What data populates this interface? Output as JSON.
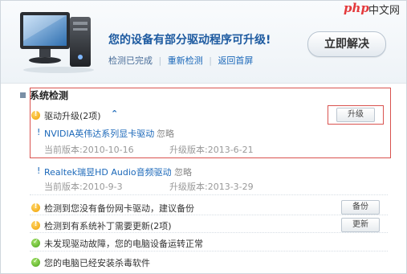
{
  "header": {
    "headline": "您的设备有部分驱动程序可升级!",
    "status_text": "检测已完成",
    "recheck_link": "重新检测",
    "back_link": "返回首屏",
    "fix_button": "立即解决"
  },
  "watermark": {
    "php": "php",
    "cn": "中文网"
  },
  "section": {
    "title": "系统检测",
    "upgrade_label": "驱动升级(2项)",
    "upgrade_button": "升级"
  },
  "drivers": [
    {
      "mark": "!",
      "name": "NVIDIA英伟达系列显卡驱动",
      "ignore": "忽略",
      "current": "当前版本:2010-10-16",
      "upgrade": "升级版本:2013-6-21"
    },
    {
      "mark": "!",
      "name": "Realtek瑞昱HD Audio音频驱动",
      "ignore": "忽略",
      "current": "当前版本:2010-9-3",
      "upgrade": "升级版本:2013-3-29"
    }
  ],
  "checks": [
    {
      "label": "检测到您没有备份网卡驱动，建议备份",
      "button": "备份",
      "status": "warning"
    },
    {
      "label": "检测到有系统补丁需要更新(2项)",
      "button": "更新",
      "status": "warning"
    },
    {
      "label": "未发现驱动故障，您的电脑设备运转正常",
      "status": "ok"
    },
    {
      "label": "您的电脑已经安装杀毒软件",
      "status": "ok"
    }
  ],
  "colors": {
    "accent": "#1b68b9",
    "warning": "#f0a000",
    "ok": "#4aa319",
    "highlight_box": "#d9534f"
  },
  "icons": [
    "monitor-illustration",
    "warning-icon",
    "ok-icon",
    "collapse-up-icon"
  ]
}
